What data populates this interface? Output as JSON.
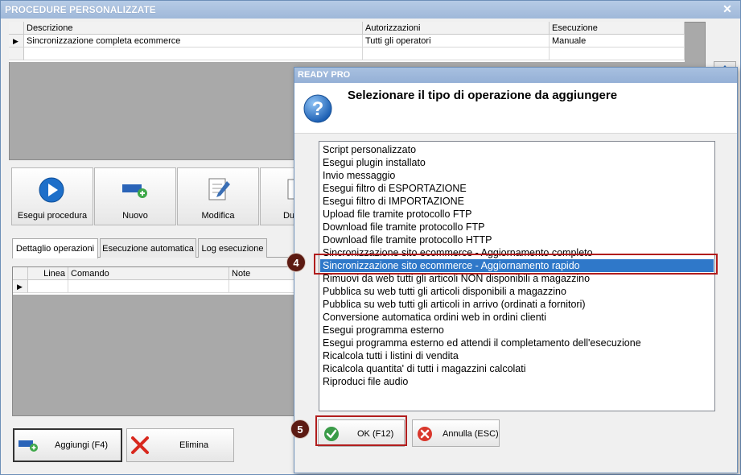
{
  "main_window": {
    "title": "PROCEDURE PERSONALIZZATE",
    "close_glyph": "✕",
    "grid": {
      "columns": [
        "Descrizione",
        "Autorizzazioni",
        "Esecuzione"
      ],
      "rows": [
        {
          "marker": "▶",
          "cells": [
            "Sincronizzazione completa ecommerce",
            "Tutti gli operatori",
            "Manuale"
          ]
        }
      ]
    },
    "toolbar": {
      "run": "Esegui procedura",
      "new": "Nuovo",
      "edit": "Modifica",
      "duplicate": "Du"
    },
    "tabs": [
      "Dettaglio operazioni",
      "Esecuzione automatica",
      "Log esecuzione"
    ],
    "op_grid": {
      "columns": [
        "Linea",
        "Comando",
        "Note"
      ],
      "marker": "▶"
    },
    "buttons": {
      "add": "Aggiungi (F4)",
      "delete": "Elimina"
    }
  },
  "dialog": {
    "title": "READY PRO",
    "heading": "Selezionare il tipo di operazione da aggiungere",
    "items": [
      "Script personalizzato",
      "Esegui plugin installato",
      "Invio messaggio",
      "Esegui filtro di ESPORTAZIONE",
      "Esegui filtro di IMPORTAZIONE",
      "Upload file tramite protocollo FTP",
      "Download file tramite protocollo FTP",
      "Download file tramite protocollo HTTP",
      "Sincronizzazione sito ecommerce - Aggiornamento completo",
      "Sincronizzazione sito ecommerce - Aggiornamento rapido",
      "Rimuovi da web tutti gli articoli NON disponibili a magazzino",
      "Pubblica su web tutti gli articoli disponibili a magazzino",
      "Pubblica su web tutti gli articoli in arrivo (ordinati a fornitori)",
      "Conversione automatica ordini web in ordini clienti",
      "Esegui programma esterno",
      "Esegui programma esterno ed attendi il completamento dell'esecuzione",
      "Ricalcola tutti i listini di vendita",
      "Ricalcola quantita' di tutti i magazzini calcolati",
      "Riproduci file audio"
    ],
    "selected_index": 9,
    "ok": "OK (F12)",
    "cancel": "Annulla (ESC)"
  },
  "badges": {
    "step4": "4",
    "step5": "5"
  },
  "colors": {
    "selection": "#2f78c9",
    "highlight": "#b11d1d",
    "badge": "#5c1a12"
  }
}
